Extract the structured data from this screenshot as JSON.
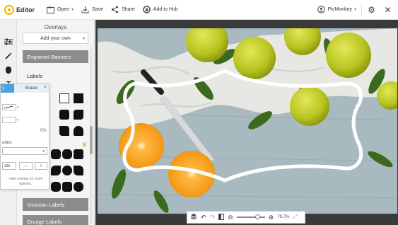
{
  "toolbar": {
    "app_name": "Editor",
    "open_label": "Open",
    "save_label": "Save",
    "share_label": "Share",
    "add_to_hub_label": "Add to Hub",
    "account_label": "PicMonkey"
  },
  "panel": {
    "title": "Overlays",
    "add_own_label": "Add your own",
    "categories": [
      "Engraved Banners",
      "Labels",
      "Victorian Labels",
      "Grunge Labels"
    ]
  },
  "overlay_tools": {
    "tab_overlay": "y",
    "tab_eraser": "Eraser",
    "fade_value": "0%",
    "blend_label": "odes:",
    "paste_label": "ate",
    "hint_line1": "-click overlay for more",
    "hint_line2": "options."
  },
  "zoom": {
    "value": "79.7%"
  },
  "colors": {
    "accent": "#4aa3df",
    "logo": "#f5b400",
    "category_bg": "#8c8c8c"
  }
}
